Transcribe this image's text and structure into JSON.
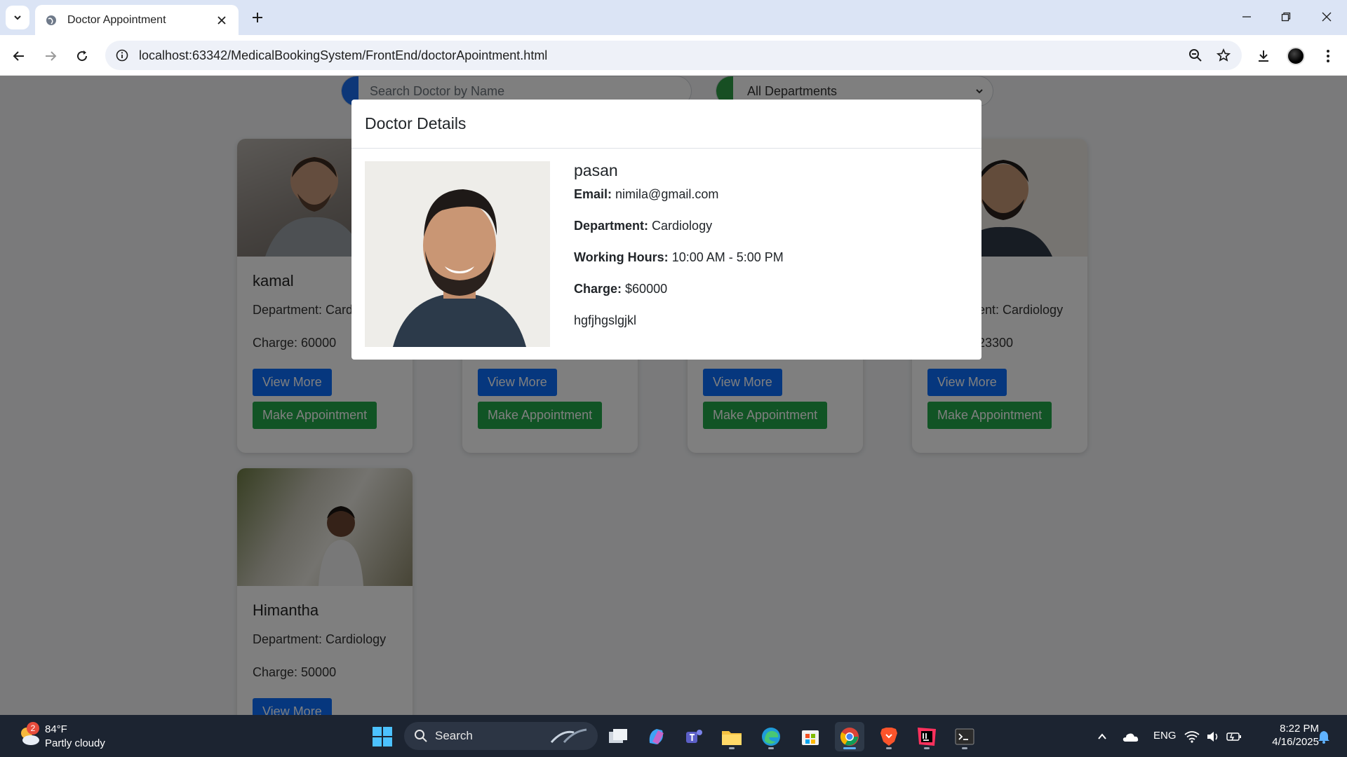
{
  "browser": {
    "tab_title": "Doctor Appointment",
    "url": "localhost:63342/MedicalBookingSystem/FrontEnd/doctorApointment.html"
  },
  "page": {
    "search_placeholder": "Search Doctor by Name",
    "department_filter": "All Departments",
    "cards": [
      {
        "name": "kamal",
        "department": "Department: Card",
        "charge": "Charge: 60000",
        "view_more": "View More",
        "make_appointment": "Make Appointment"
      },
      {
        "name": "",
        "department": "",
        "charge": "",
        "view_more": "View More",
        "make_appointment": "Make Appointment"
      },
      {
        "name": "",
        "department": "",
        "charge": "",
        "view_more": "View More",
        "make_appointment": "Make Appointment"
      },
      {
        "name": "",
        "department": "ent: Cardiology",
        "charge": "23300",
        "view_more": "View More",
        "make_appointment": "Make Appointment"
      },
      {
        "name": "Himantha",
        "department": "Department: Cardiology",
        "charge": "Charge: 50000",
        "view_more": "View More"
      }
    ]
  },
  "modal": {
    "title": "Doctor Details",
    "name": "pasan",
    "email_label": "Email:",
    "email": "nimila@gmail.com",
    "department_label": "Department:",
    "department": "Cardiology",
    "hours_label": "Working Hours:",
    "hours": "10:00 AM - 5:00 PM",
    "charge_label": "Charge:",
    "charge": "$60000",
    "description": "hgfjhgslgjkl"
  },
  "taskbar": {
    "weather_badge": "2",
    "weather_temp": "84°F",
    "weather_desc": "Partly cloudy",
    "search_label": "Search",
    "language": "ENG",
    "time": "8:22 PM",
    "date": "4/16/2025"
  }
}
